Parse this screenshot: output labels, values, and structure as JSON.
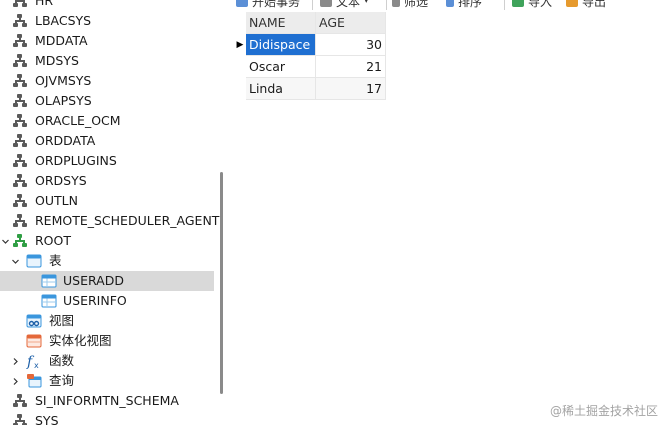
{
  "tree": {
    "items": [
      {
        "label": "HR",
        "type": "schema"
      },
      {
        "label": "LBACSYS",
        "type": "schema"
      },
      {
        "label": "MDDATA",
        "type": "schema"
      },
      {
        "label": "MDSYS",
        "type": "schema"
      },
      {
        "label": "OJVMSYS",
        "type": "schema"
      },
      {
        "label": "OLAPSYS",
        "type": "schema"
      },
      {
        "label": "ORACLE_OCM",
        "type": "schema"
      },
      {
        "label": "ORDDATA",
        "type": "schema"
      },
      {
        "label": "ORDPLUGINS",
        "type": "schema"
      },
      {
        "label": "ORDSYS",
        "type": "schema"
      },
      {
        "label": "OUTLN",
        "type": "schema"
      },
      {
        "label": "REMOTE_SCHEDULER_AGENT",
        "type": "schema"
      },
      {
        "label": "ROOT",
        "type": "schema-open"
      },
      {
        "label": "表",
        "type": "tables-folder"
      },
      {
        "label": "USERADD",
        "type": "table",
        "selected": true
      },
      {
        "label": "USERINFO",
        "type": "table"
      },
      {
        "label": "视图",
        "type": "views"
      },
      {
        "label": "实体化视图",
        "type": "mviews"
      },
      {
        "label": "函数",
        "type": "functions"
      },
      {
        "label": "查询",
        "type": "queries"
      },
      {
        "label": "SI_INFORMTN_SCHEMA",
        "type": "schema"
      },
      {
        "label": "SYS",
        "type": "schema"
      }
    ]
  },
  "toolbar": {
    "begin_txn": "开始事务",
    "text": "文本",
    "filter": "筛选",
    "sort": "排序",
    "import": "导入",
    "export": "导出"
  },
  "grid": {
    "columns": [
      "NAME",
      "AGE"
    ],
    "rows": [
      {
        "name": "Didispace",
        "age": "30"
      },
      {
        "name": "Oscar",
        "age": "21"
      },
      {
        "name": "Linda",
        "age": "17"
      }
    ]
  },
  "watermark": "@稀土掘金技术社区",
  "colors": {
    "selection": "#1f6fd1",
    "tree_selected": "#d9d9d9",
    "schema_icon": "#5a5a5a",
    "schema_icon_active": "#2f9e44"
  }
}
